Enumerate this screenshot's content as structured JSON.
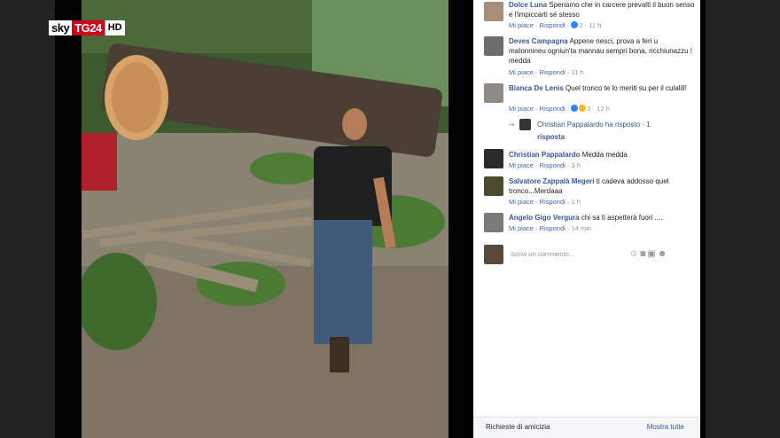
{
  "logo": {
    "sky": "sky",
    "tg24": "TG24",
    "hd": "HD"
  },
  "comments": [
    {
      "name": "Dolce Luna",
      "text": "Speriamo che in carcere prevalti il buon senso e l'impiccarti sé stesso",
      "actions": "Mi piace · Rispondi ·",
      "reactions": "2",
      "time": "11 h"
    },
    {
      "name": "Deves Campagna",
      "text": "Appene nesci, prova a feri u matonnineu ogniun'ta mannau sempri bona, ricchiunazzu !",
      "tail": "medda",
      "actions": "Mi piace · Rispondi ·",
      "time": "11 h"
    },
    {
      "name": "Bianca De Lenis",
      "text": "Quel tronco te lo meriti su per il culalill!",
      "actions": "Mi piace · Rispondi ·",
      "reactions": "2",
      "time": "12 h"
    },
    {
      "name": "Christian Pappalardo",
      "text": "Medda medda",
      "actions": "Mi piace · Rispondi ·",
      "time": "3 h"
    },
    {
      "name": "Salvatore Zappalà Megeri",
      "text": "ti cadeva addosso quel tronco...Merdaaa",
      "actions": "Mi piace · Rispondi ·",
      "time": "1 h"
    },
    {
      "name": "Angelo Gigo Vergura",
      "text": "chi sa ti aspetterà fuori ....",
      "actions": "Mi piace · Rispondi ·",
      "time": "14 min"
    }
  ],
  "reply": {
    "author": "Christian Pappalardo ha risposto",
    "count": "· 1",
    "label": "risposta"
  },
  "input": {
    "placeholder": "Scrivi un commento..."
  },
  "footer": {
    "left": "Richieste di amicizia",
    "right": "Mostra tutte"
  }
}
